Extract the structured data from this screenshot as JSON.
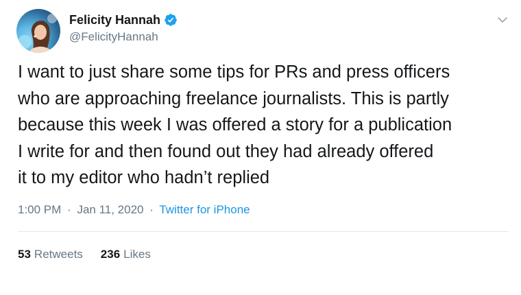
{
  "user": {
    "display_name": "Felicity Hannah",
    "handle": "@FelicityHannah",
    "verified": true,
    "avatar_icon": "profile-photo"
  },
  "tweet": {
    "lines": [
      "I want to just share some tips for PRs and press officers",
      "who are approaching freelance journalists. This is partly",
      "because this week I was offered a story for a publication",
      "I write for and then found out they had already offered",
      "it to my editor who hadn’t replied"
    ]
  },
  "meta": {
    "time": "1:00 PM",
    "date": "Jan 11, 2020",
    "separator": "·",
    "source": "Twitter for iPhone"
  },
  "stats": {
    "retweets_count": "53",
    "retweets_label": "Retweets",
    "likes_count": "236",
    "likes_label": "Likes"
  },
  "colors": {
    "text": "#14171a",
    "secondary": "#657786",
    "link": "#1b95e0",
    "divider": "#e1e8ed",
    "verified": "#1da1f2"
  }
}
